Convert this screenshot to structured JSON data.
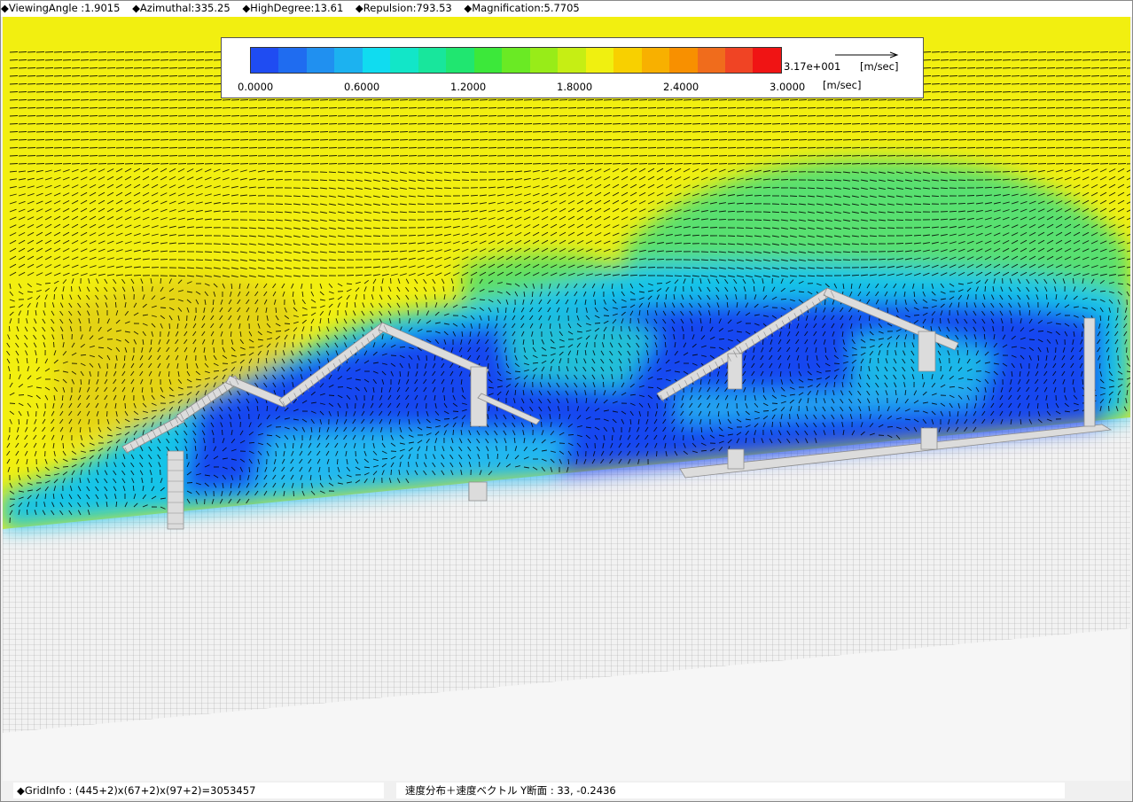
{
  "header": {
    "viewing_angle": "◆ViewingAngle :1.9015",
    "azimuthal": "◆Azimuthal:335.25",
    "high_degree": "◆HighDegree:13.61",
    "repulsion": "◆Repulsion:793.53",
    "magnification": "◆Magnification:5.7705"
  },
  "legend": {
    "colors": [
      "#1f4cf2",
      "#1f6cf0",
      "#2090f0",
      "#1cb2f0",
      "#10dcf0",
      "#12e6c8",
      "#18e69c",
      "#20e670",
      "#3ce83a",
      "#6aea24",
      "#98ec18",
      "#c6ee14",
      "#f0f010",
      "#f8d000",
      "#f8b000",
      "#f89000",
      "#f06c1c",
      "#f04424",
      "#f01414"
    ],
    "ticks": [
      "0.0000",
      "0.6000",
      "1.2000",
      "1.8000",
      "2.4000",
      "3.0000"
    ],
    "vector_reference": "3.17e+001",
    "vector_unit": "[m/sec]",
    "scale_unit": "[m/sec]"
  },
  "footer": {
    "grid_info": "◆GridInfo : (445+2)x(67+2)x(97+2)=3053457",
    "section_info": "速度分布＋速度ベクトル Y断面 : 33,  -0.2436"
  },
  "colors": {
    "high_speed": "#f2ef10",
    "mid_speed": "#40e060",
    "low_speed": "#1846f0",
    "structure": "#dcdcdc",
    "grid_line": "#a8a8a8"
  }
}
